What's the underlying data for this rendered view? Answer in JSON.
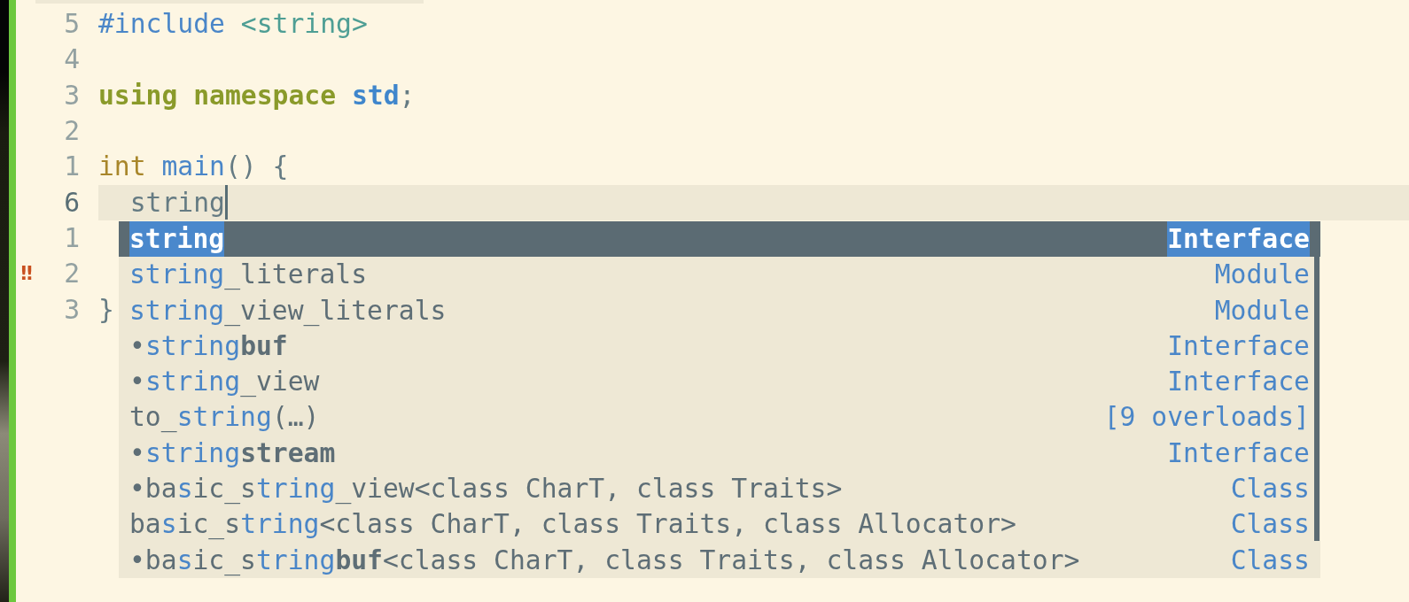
{
  "editor": {
    "lines": [
      {
        "number": "5",
        "current": false,
        "tokens": [
          {
            "text": "#include",
            "kind": "preprocessor"
          },
          {
            "text": " <string>",
            "kind": "string"
          }
        ]
      },
      {
        "number": "4",
        "current": false
      },
      {
        "number": "3",
        "current": false,
        "tokens": [
          {
            "text": "using namespace",
            "kind": "keyword"
          },
          {
            "text": " std",
            "kind": "namespace"
          },
          {
            "text": ";",
            "kind": "plain"
          }
        ]
      },
      {
        "number": "2",
        "current": false
      },
      {
        "number": "1",
        "current": false,
        "tokens": [
          {
            "text": "int",
            "kind": "type"
          },
          {
            "text": " main",
            "kind": "function"
          },
          {
            "text": "() {",
            "kind": "plain"
          }
        ]
      },
      {
        "number": "6",
        "current": true,
        "tokens": [
          {
            "text": "  string",
            "kind": "plain"
          }
        ]
      },
      {
        "number": "1",
        "current": false
      },
      {
        "number": "2",
        "current": false,
        "sign": "‼"
      },
      {
        "number": "3",
        "current": false,
        "tokens": [
          {
            "text": "}",
            "kind": "plain"
          }
        ]
      }
    ]
  },
  "completion": {
    "items": [
      {
        "selected": true,
        "label": [
          {
            "text": "string",
            "match": true
          }
        ],
        "detail": "Interface"
      },
      {
        "selected": false,
        "label": [
          {
            "text": "string",
            "match": true
          },
          {
            "text": "_literals",
            "match": false
          }
        ],
        "detail": "Module"
      },
      {
        "selected": false,
        "label": [
          {
            "text": "string",
            "match": true
          },
          {
            "text": "_view_literals",
            "match": false
          }
        ],
        "detail": "Module"
      },
      {
        "selected": false,
        "label": [
          {
            "text": "•",
            "match": false
          },
          {
            "text": "string",
            "match": true
          },
          {
            "text": "**buf**",
            "match": false
          }
        ],
        "detail": "Interface"
      },
      {
        "selected": false,
        "label": [
          {
            "text": "•",
            "match": false
          },
          {
            "text": "string",
            "match": true
          },
          {
            "text": "_view",
            "match": false
          }
        ],
        "detail": "Interface"
      },
      {
        "selected": false,
        "label": [
          {
            "text": "to_",
            "match": false
          },
          {
            "text": "string",
            "match": true
          },
          {
            "text": "(…)",
            "match": false
          }
        ],
        "detail": "[9 overloads]"
      },
      {
        "selected": false,
        "label": [
          {
            "text": "•",
            "match": false
          },
          {
            "text": "string",
            "match": true
          },
          {
            "text": "**stream**",
            "match": false
          }
        ],
        "detail": "Interface"
      },
      {
        "selected": false,
        "label": [
          {
            "text": "•ba",
            "match": false
          },
          {
            "text": "s",
            "match": true
          },
          {
            "text": "ic_s",
            "match": false
          },
          {
            "text": "tring",
            "match": true
          },
          {
            "text": "_view<class CharT, class Traits>",
            "match": false
          }
        ],
        "detail": "Class"
      },
      {
        "selected": false,
        "label": [
          {
            "text": "ba",
            "match": false
          },
          {
            "text": "s",
            "match": true
          },
          {
            "text": "ic_s",
            "match": false
          },
          {
            "text": "tring",
            "match": true
          },
          {
            "text": "<class CharT, class Traits, class Allocator>",
            "match": false
          }
        ],
        "detail": "Class"
      },
      {
        "selected": false,
        "label": [
          {
            "text": "•ba",
            "match": false
          },
          {
            "text": "s",
            "match": true
          },
          {
            "text": "ic_s",
            "match": false
          },
          {
            "text": "tring",
            "match": true
          },
          {
            "text": "**buf**",
            "match": false
          },
          {
            "text": "<class CharT, class Traits, class Allocator>",
            "match": false
          }
        ],
        "detail": "Class"
      }
    ]
  }
}
